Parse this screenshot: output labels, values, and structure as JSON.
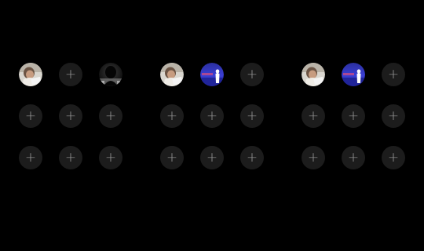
{
  "ui": {
    "add_glyph": "+"
  },
  "groups": [
    {
      "slots": [
        "photo-person-laptop",
        "empty",
        "photo-silhouette-dark",
        "empty",
        "empty",
        "empty",
        "empty",
        "empty",
        "empty"
      ]
    },
    {
      "slots": [
        "photo-person-laptop",
        "photo-silhouette-blue",
        "empty",
        "empty",
        "empty",
        "empty",
        "empty",
        "empty",
        "empty"
      ]
    },
    {
      "slots": [
        "photo-person-laptop",
        "photo-silhouette-blue",
        "empty",
        "empty",
        "empty",
        "empty",
        "empty",
        "empty",
        "empty"
      ]
    }
  ],
  "colors": {
    "background": "#000000",
    "empty_slot": "#1c1c1c",
    "plus_glyph": "#9a9a9a"
  }
}
